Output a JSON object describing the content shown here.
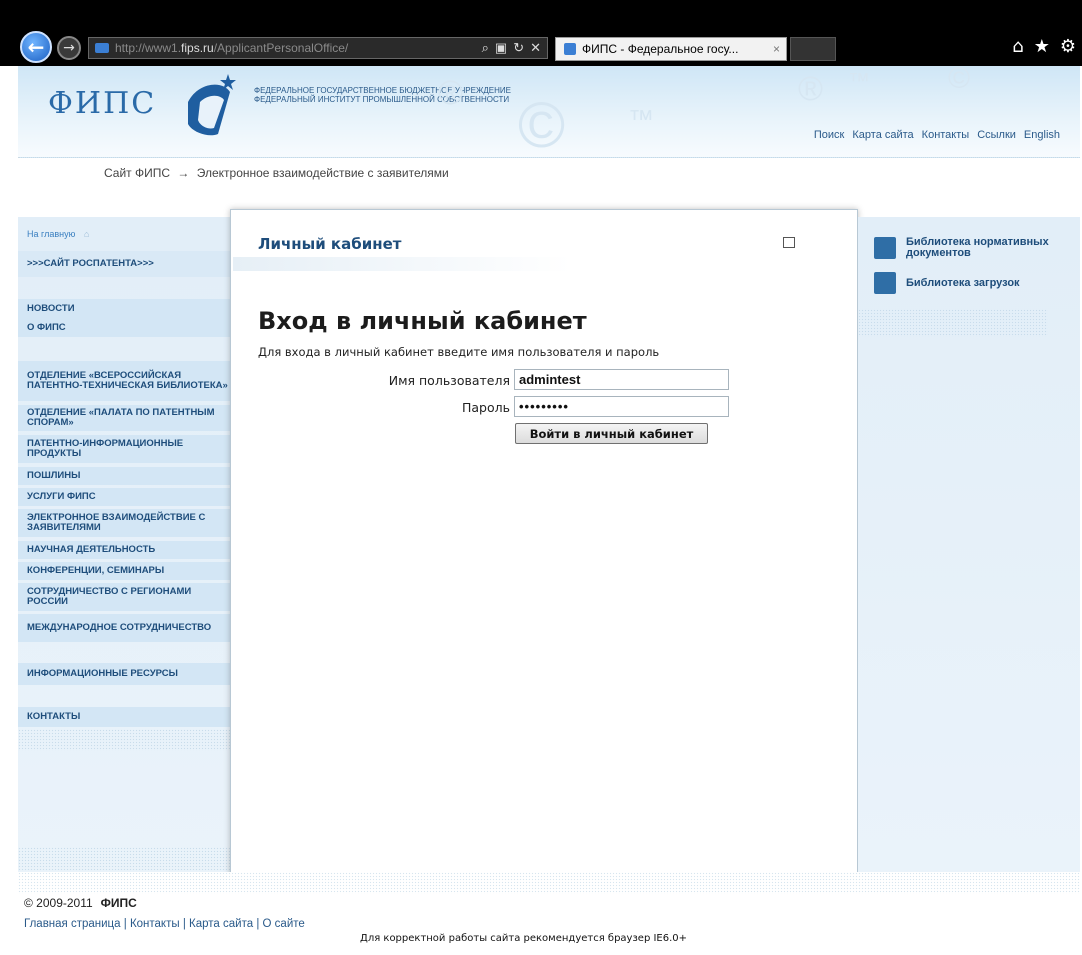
{
  "browser": {
    "url_prefix": "http://www1.",
    "url_host": "fips.ru",
    "url_path": "/ApplicantPersonalOffice/",
    "tab_title": "ФИПС - Федеральное госу...",
    "tab_close": "×"
  },
  "header": {
    "logo_text": "ФИПС",
    "inst_line1": "ФЕДЕРАЛЬНОЕ ГОСУДАРСТВЕННОЕ БЮДЖЕТНОЕ УЧРЕЖДЕНИЕ",
    "inst_line2": "ФЕДЕРАЛЬНЫЙ ИНСТИТУТ ПРОМЫШЛЕННОЙ СОБСТВЕННОСТИ",
    "top_links": [
      "Поиск",
      "Карта сайта",
      "Контакты",
      "Ссылки",
      "English"
    ]
  },
  "breadcrumb": {
    "item1": "Сайт ФИПС",
    "separator": "→",
    "item2": "Электронное взаимодействие с заявителями"
  },
  "leftnav": {
    "home": "На главную",
    "items": [
      ">>>САЙТ РОСПАТЕНТА>>>",
      "НОВОСТИ",
      "О ФИПС",
      "ОТДЕЛЕНИЕ «ВСЕРОССИЙСКАЯ ПАТЕНТНО-ТЕХНИЧЕСКАЯ БИБЛИОТЕКА»",
      "ОТДЕЛЕНИЕ «ПАЛАТА ПО ПАТЕНТНЫМ СПОРАМ»",
      "ПАТЕНТНО-ИНФОРМАЦИОННЫЕ ПРОДУКТЫ",
      "ПОШЛИНЫ",
      "УСЛУГИ ФИПС",
      "ЭЛЕКТРОННОЕ ВЗАИМОДЕЙСТВИЕ С ЗАЯВИТЕЛЯМИ",
      "НАУЧНАЯ ДЕЯТЕЛЬНОСТЬ",
      "КОНФЕРЕНЦИИ, СЕМИНАРЫ",
      "СОТРУДНИЧЕСТВО С РЕГИОНАМИ РОССИИ",
      "МЕЖДУНАРОДНОЕ СОТРУДНИЧЕСТВО",
      "ИНФОРМАЦИОННЫЕ РЕСУРСЫ",
      "КОНТАКТЫ"
    ]
  },
  "panel": {
    "section_title": "Личный кабинет",
    "heading": "Вход в личный кабинет",
    "hint": "Для входа в личный кабинет введите имя пользователя и пароль",
    "username_label": "Имя пользователя",
    "username_value": "admintest",
    "password_label": "Пароль",
    "password_mask": "•••••••••",
    "submit_label": "Войти в личный кабинет"
  },
  "right": {
    "items": [
      "Библиотека нормативных документов",
      "Библиотека загрузок"
    ]
  },
  "footer": {
    "copyright": "© 2009-2011",
    "brand": "ФИПС",
    "links": [
      "Главная страница",
      "Контакты",
      "Карта сайта",
      "О сайте"
    ],
    "link_sep": "|",
    "recommend": "Для корректной работы сайта рекомендуется браузер IE6.0+"
  }
}
